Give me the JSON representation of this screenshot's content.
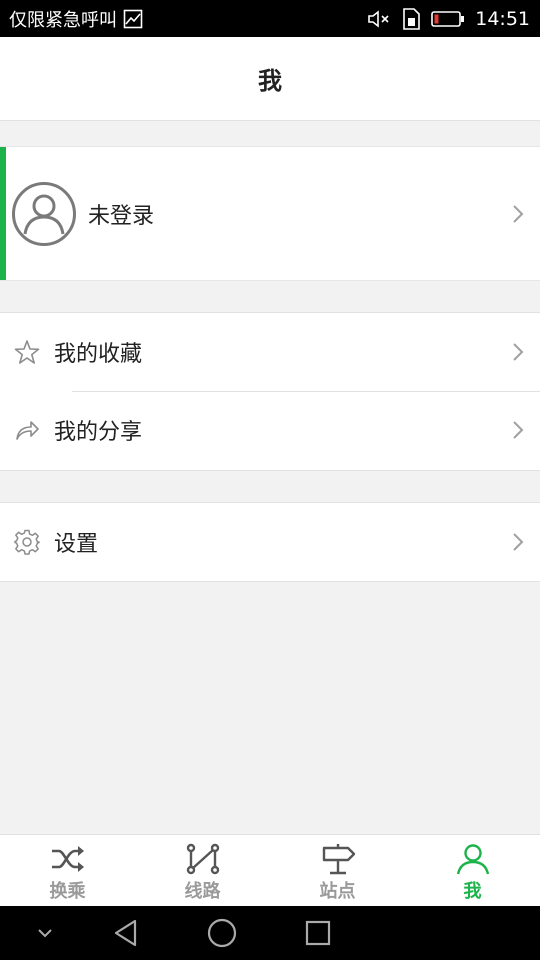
{
  "status_bar": {
    "carrier_text": "仅限紧急呼叫",
    "time": "14:51",
    "icons": [
      "gallery-icon",
      "mute-icon",
      "sim-icon",
      "battery-icon"
    ]
  },
  "header": {
    "title": "我"
  },
  "profile": {
    "name": "未登录",
    "avatar_icon": "user-avatar-icon"
  },
  "menu_group_1": [
    {
      "label": "我的收藏",
      "icon": "star-icon"
    },
    {
      "label": "我的分享",
      "icon": "share-icon"
    }
  ],
  "menu_group_2": [
    {
      "label": "设置",
      "icon": "gear-icon"
    }
  ],
  "tabs": [
    {
      "label": "换乘",
      "icon": "shuffle-icon",
      "active": false
    },
    {
      "label": "线路",
      "icon": "route-icon",
      "active": false
    },
    {
      "label": "站点",
      "icon": "signpost-icon",
      "active": false
    },
    {
      "label": "我",
      "icon": "person-icon",
      "active": true
    }
  ],
  "colors": {
    "accent": "#1db34a",
    "text": "#222222",
    "muted": "#9a9a9a",
    "background": "#f2f2f2"
  }
}
